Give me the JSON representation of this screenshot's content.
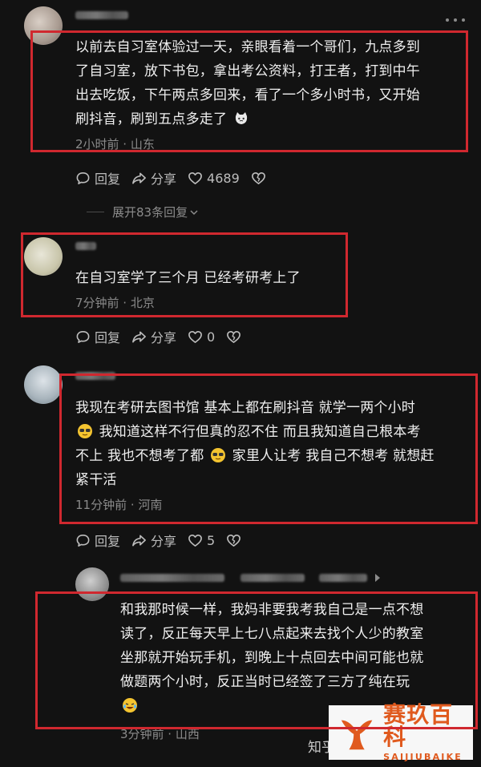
{
  "comments": [
    {
      "text_lines": [
        "以前去自习室体验过一天，亲眼看着一个哥们，九点多到",
        "了自习室，放下书包，拿出考公资料，打王者，打到中午",
        "出去吃饭，下午两点多回来，看了一个多小时书，又开始",
        "刷抖音，刷到五点多走了"
      ],
      "meta": "2小时前 · 山东",
      "reply_label": "回复",
      "share_label": "分享",
      "like_count": "4689",
      "expand_label": "展开83条回复"
    },
    {
      "text_lines": [
        "在自习室学了三个月 已经考研考上了"
      ],
      "meta": "7分钟前 · 北京",
      "reply_label": "回复",
      "share_label": "分享",
      "like_count": "0"
    },
    {
      "text_lines": [
        "我现在考研去图书馆 基本上都在刷抖音 就学一两个小时",
        "我知道这样不行但真的忍不住 而且我知道自己根本考",
        "不上 我也不想考了都",
        "家里人让考 我自己不想考 就想赶",
        "紧干活"
      ],
      "meta": "11分钟前 · 河南",
      "reply_label": "回复",
      "share_label": "分享",
      "like_count": "5"
    },
    {
      "text_lines": [
        "和我那时候一样，我妈非要我考我自己是一点不想",
        "读了，反正每天早上七八点起来去找个人少的教室",
        "坐那就开始玩手机，到晚上十点回去中间可能也就",
        "做题两个小时，反正当时已经签了三方了纯在玩"
      ],
      "meta": "3分钟前 · 山西"
    }
  ],
  "watermark": {
    "cn": "赛玖百科",
    "en": "SAIJIUBAIKE"
  },
  "bottom_label": "知乎",
  "colors": {
    "background": "#121212",
    "highlight_box": "#d0282f",
    "meta_text": "#8b8b8b",
    "watermark_orange": "#e05a1e"
  }
}
